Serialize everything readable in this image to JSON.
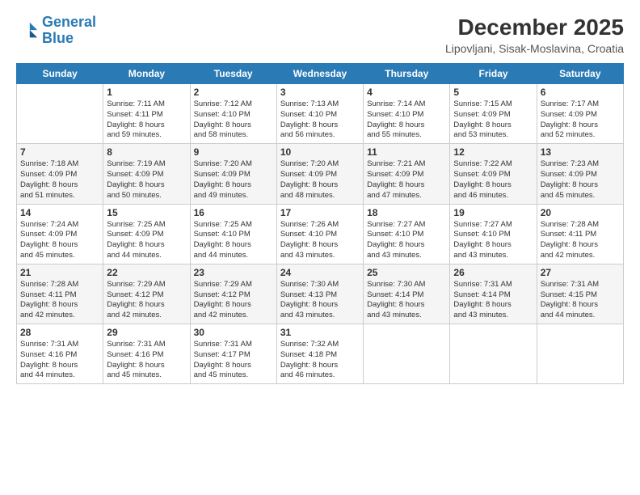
{
  "header": {
    "logo_line1": "General",
    "logo_line2": "Blue",
    "month_year": "December 2025",
    "location": "Lipovljani, Sisak-Moslavina, Croatia"
  },
  "weekdays": [
    "Sunday",
    "Monday",
    "Tuesday",
    "Wednesday",
    "Thursday",
    "Friday",
    "Saturday"
  ],
  "weeks": [
    [
      {
        "day": "",
        "info": ""
      },
      {
        "day": "1",
        "info": "Sunrise: 7:11 AM\nSunset: 4:11 PM\nDaylight: 8 hours\nand 59 minutes."
      },
      {
        "day": "2",
        "info": "Sunrise: 7:12 AM\nSunset: 4:10 PM\nDaylight: 8 hours\nand 58 minutes."
      },
      {
        "day": "3",
        "info": "Sunrise: 7:13 AM\nSunset: 4:10 PM\nDaylight: 8 hours\nand 56 minutes."
      },
      {
        "day": "4",
        "info": "Sunrise: 7:14 AM\nSunset: 4:10 PM\nDaylight: 8 hours\nand 55 minutes."
      },
      {
        "day": "5",
        "info": "Sunrise: 7:15 AM\nSunset: 4:09 PM\nDaylight: 8 hours\nand 53 minutes."
      },
      {
        "day": "6",
        "info": "Sunrise: 7:17 AM\nSunset: 4:09 PM\nDaylight: 8 hours\nand 52 minutes."
      }
    ],
    [
      {
        "day": "7",
        "info": "Sunrise: 7:18 AM\nSunset: 4:09 PM\nDaylight: 8 hours\nand 51 minutes."
      },
      {
        "day": "8",
        "info": "Sunrise: 7:19 AM\nSunset: 4:09 PM\nDaylight: 8 hours\nand 50 minutes."
      },
      {
        "day": "9",
        "info": "Sunrise: 7:20 AM\nSunset: 4:09 PM\nDaylight: 8 hours\nand 49 minutes."
      },
      {
        "day": "10",
        "info": "Sunrise: 7:20 AM\nSunset: 4:09 PM\nDaylight: 8 hours\nand 48 minutes."
      },
      {
        "day": "11",
        "info": "Sunrise: 7:21 AM\nSunset: 4:09 PM\nDaylight: 8 hours\nand 47 minutes."
      },
      {
        "day": "12",
        "info": "Sunrise: 7:22 AM\nSunset: 4:09 PM\nDaylight: 8 hours\nand 46 minutes."
      },
      {
        "day": "13",
        "info": "Sunrise: 7:23 AM\nSunset: 4:09 PM\nDaylight: 8 hours\nand 45 minutes."
      }
    ],
    [
      {
        "day": "14",
        "info": "Sunrise: 7:24 AM\nSunset: 4:09 PM\nDaylight: 8 hours\nand 45 minutes."
      },
      {
        "day": "15",
        "info": "Sunrise: 7:25 AM\nSunset: 4:09 PM\nDaylight: 8 hours\nand 44 minutes."
      },
      {
        "day": "16",
        "info": "Sunrise: 7:25 AM\nSunset: 4:10 PM\nDaylight: 8 hours\nand 44 minutes."
      },
      {
        "day": "17",
        "info": "Sunrise: 7:26 AM\nSunset: 4:10 PM\nDaylight: 8 hours\nand 43 minutes."
      },
      {
        "day": "18",
        "info": "Sunrise: 7:27 AM\nSunset: 4:10 PM\nDaylight: 8 hours\nand 43 minutes."
      },
      {
        "day": "19",
        "info": "Sunrise: 7:27 AM\nSunset: 4:10 PM\nDaylight: 8 hours\nand 43 minutes."
      },
      {
        "day": "20",
        "info": "Sunrise: 7:28 AM\nSunset: 4:11 PM\nDaylight: 8 hours\nand 42 minutes."
      }
    ],
    [
      {
        "day": "21",
        "info": "Sunrise: 7:28 AM\nSunset: 4:11 PM\nDaylight: 8 hours\nand 42 minutes."
      },
      {
        "day": "22",
        "info": "Sunrise: 7:29 AM\nSunset: 4:12 PM\nDaylight: 8 hours\nand 42 minutes."
      },
      {
        "day": "23",
        "info": "Sunrise: 7:29 AM\nSunset: 4:12 PM\nDaylight: 8 hours\nand 42 minutes."
      },
      {
        "day": "24",
        "info": "Sunrise: 7:30 AM\nSunset: 4:13 PM\nDaylight: 8 hours\nand 43 minutes."
      },
      {
        "day": "25",
        "info": "Sunrise: 7:30 AM\nSunset: 4:14 PM\nDaylight: 8 hours\nand 43 minutes."
      },
      {
        "day": "26",
        "info": "Sunrise: 7:31 AM\nSunset: 4:14 PM\nDaylight: 8 hours\nand 43 minutes."
      },
      {
        "day": "27",
        "info": "Sunrise: 7:31 AM\nSunset: 4:15 PM\nDaylight: 8 hours\nand 44 minutes."
      }
    ],
    [
      {
        "day": "28",
        "info": "Sunrise: 7:31 AM\nSunset: 4:16 PM\nDaylight: 8 hours\nand 44 minutes."
      },
      {
        "day": "29",
        "info": "Sunrise: 7:31 AM\nSunset: 4:16 PM\nDaylight: 8 hours\nand 45 minutes."
      },
      {
        "day": "30",
        "info": "Sunrise: 7:31 AM\nSunset: 4:17 PM\nDaylight: 8 hours\nand 45 minutes."
      },
      {
        "day": "31",
        "info": "Sunrise: 7:32 AM\nSunset: 4:18 PM\nDaylight: 8 hours\nand 46 minutes."
      },
      {
        "day": "",
        "info": ""
      },
      {
        "day": "",
        "info": ""
      },
      {
        "day": "",
        "info": ""
      }
    ]
  ]
}
